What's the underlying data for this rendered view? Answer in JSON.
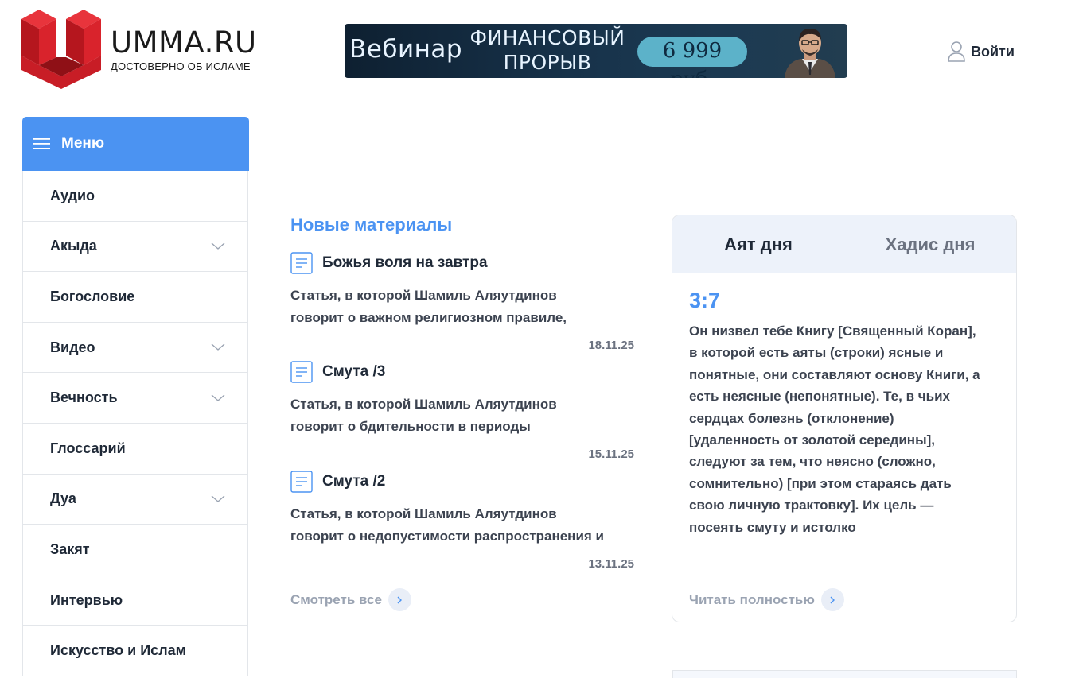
{
  "colors": {
    "accent": "#4b93f2",
    "logo_red": "#cf1b24",
    "muted": "#9aa3b2"
  },
  "header": {
    "logo": {
      "title": "UMMA.RU",
      "tagline": "ДОСТОВЕРНО ОБ ИСЛАМЕ",
      "icon": "umma-logo-icon"
    },
    "banner": {
      "word": "Вебинар",
      "headline": "ФИНАНСОВЫЙ ПРОРЫВ",
      "price": "6 999 руб."
    },
    "login": {
      "label": "Войти",
      "icon": "user-icon"
    }
  },
  "menu": {
    "title": "Меню",
    "icon": "hamburger-icon",
    "items": [
      {
        "label": "Аудио",
        "has_children": false
      },
      {
        "label": "Акыда",
        "has_children": true
      },
      {
        "label": "Богословие",
        "has_children": false
      },
      {
        "label": "Видео",
        "has_children": true
      },
      {
        "label": "Вечность",
        "has_children": true
      },
      {
        "label": "Глоссарий",
        "has_children": false
      },
      {
        "label": "Дуа",
        "has_children": true
      },
      {
        "label": "Закят",
        "has_children": false
      },
      {
        "label": "Интервью",
        "has_children": false
      },
      {
        "label": "Искусство и Ислам",
        "has_children": false
      }
    ]
  },
  "news": {
    "title": "Новые материалы",
    "articles": [
      {
        "title": "Божья воля на завтра",
        "desc_line1": "Статья, в которой Шамиль Аляутдинов",
        "desc_line2": "говорит о важном религиозном правиле,",
        "date": "18.11.25"
      },
      {
        "title": "Смута /3",
        "desc_line1": "Статья, в которой Шамиль Аляутдинов",
        "desc_line2": "говорит о бдительности в периоды",
        "date": "15.11.25"
      },
      {
        "title": "Смута /2",
        "desc_line1": "Статья, в которой Шамиль Аляутдинов",
        "desc_line2": "говорит о недопустимости распространения и",
        "date": "13.11.25"
      }
    ],
    "see_all": "Смотреть все"
  },
  "daily": {
    "tabs": [
      {
        "label": "Аят дня",
        "active": true
      },
      {
        "label": "Хадис дня",
        "active": false
      }
    ],
    "reference": "3:7",
    "lines": [
      "Он низвел тебе Книгу [Священный Коран],",
      "в которой есть аяты (строки) ясные и",
      "понятные, они составляют основу Книги, а",
      "есть неясные (непонятные). Те, в чьих",
      "сердцах болезнь (отклонение)",
      "[удаленность от золотой середины],",
      "следуют за тем, что неясно (сложно,",
      "сомнительно) [при этом стараясь дать",
      "свою личную трактовку]. Их цель —",
      "посеять смуту и истолко"
    ],
    "read_more": "Читать полностью"
  }
}
